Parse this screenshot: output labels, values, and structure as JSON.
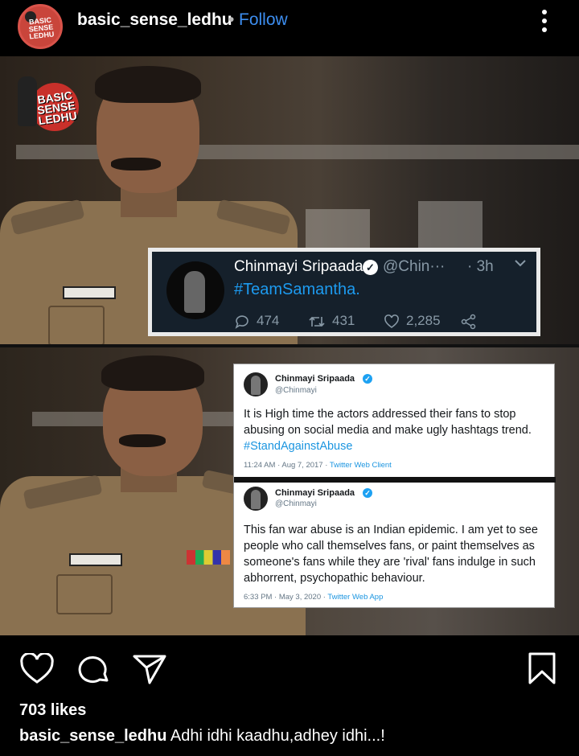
{
  "header": {
    "username": "basic_sense_ledhu",
    "separator": "•",
    "follow_label": "Follow",
    "avatar_text": "BASIC SENSE LEDHU"
  },
  "post": {
    "watermark_text": "BASIC SENSE LEDHU",
    "tweet_dark": {
      "name": "Chinmayi Sripaada",
      "verified_glyph": "✓",
      "handle": "@Chin···",
      "time": "· 3h",
      "hashtag": "#TeamSamantha.",
      "replies": "474",
      "retweets": "431",
      "likes": "2,285",
      "theme_bg": "#15202b"
    },
    "tweet_light_1": {
      "name": "Chinmayi Sripaada",
      "verified_glyph": "✓",
      "handle": "@Chinmayi",
      "text": "It is High time the actors addressed their fans to stop abusing on social media and make ugly hashtags trend.",
      "hashtag": "#StandAgainstAbuse",
      "date": "11:24 AM · Aug 7, 2017 · ",
      "client": "Twitter Web Client"
    },
    "tweet_light_2": {
      "name": "Chinmayi Sripaada",
      "verified_glyph": "✓",
      "handle": "@Chinmayi",
      "text": "This fan war abuse is an Indian epidemic. I am yet to see people who call themselves fans, or paint themselves as someone's fans while they are 'rival' fans indulge in such abhorrent, psychopathic behaviour.",
      "date": "6:33 PM · May 3, 2020 · ",
      "client": "Twitter Web App"
    }
  },
  "actions": {
    "icons": [
      "heart-icon",
      "comment-icon",
      "share-icon",
      "bookmark-icon"
    ]
  },
  "likes_text": "703 likes",
  "caption": {
    "username": "basic_sense_ledhu",
    "text": " Adhi idhi kaadhu,adhey idhi...!"
  },
  "colors": {
    "background": "#000000",
    "link_blue": "#3d8ef0",
    "twitter_blue": "#1d9bf0"
  }
}
